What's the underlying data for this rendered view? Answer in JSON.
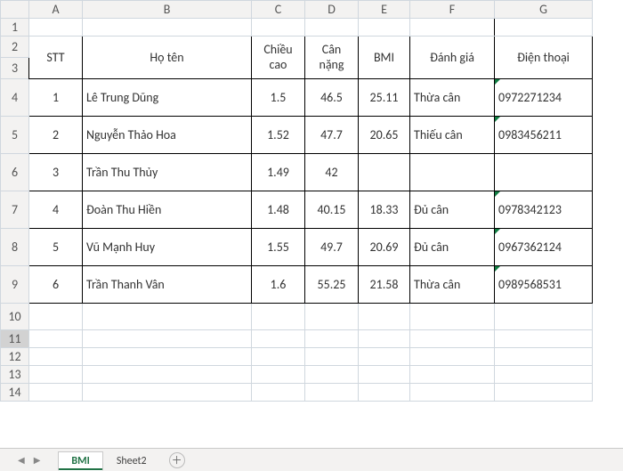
{
  "columns": [
    "A",
    "B",
    "C",
    "D",
    "E",
    "F",
    "G"
  ],
  "row_labels": [
    "1",
    "2",
    "3",
    "4",
    "5",
    "6",
    "7",
    "8",
    "9",
    "10",
    "11",
    "12",
    "13",
    "14"
  ],
  "headers": {
    "A": "STT",
    "B": "Họ tên",
    "C": "Chiều cao",
    "D": "Cân nặng",
    "E": "BMI",
    "F": "Đánh giá",
    "G": "Điện thoại"
  },
  "chart_data": {
    "type": "table",
    "rows": [
      {
        "stt": "1",
        "ho_ten": "Lê Trung Dũng",
        "chieu_cao": "1.5",
        "can_nang": "46.5",
        "bmi": "25.11",
        "danh_gia": "Thừa cân",
        "dien_thoai": "0972271234"
      },
      {
        "stt": "2",
        "ho_ten": "Nguyễn Thảo Hoa",
        "chieu_cao": "1.52",
        "can_nang": "47.7",
        "bmi": "20.65",
        "danh_gia": "Thiếu cân",
        "dien_thoai": "0983456211"
      },
      {
        "stt": "3",
        "ho_ten": "Trần Thu Thủy",
        "chieu_cao": "1.49",
        "can_nang": "42",
        "bmi": "",
        "danh_gia": "",
        "dien_thoai": ""
      },
      {
        "stt": "4",
        "ho_ten": "Đoàn Thu Hiền",
        "chieu_cao": "1.48",
        "can_nang": "40.15",
        "bmi": "18.33",
        "danh_gia": "Đủ cân",
        "dien_thoai": "0978342123"
      },
      {
        "stt": "5",
        "ho_ten": "Vũ Mạnh Huy",
        "chieu_cao": "1.55",
        "can_nang": "49.7",
        "bmi": "20.69",
        "danh_gia": "Đủ cân",
        "dien_thoai": "0967362124"
      },
      {
        "stt": "6",
        "ho_ten": "Trần Thanh Vân",
        "chieu_cao": "1.6",
        "can_nang": "55.25",
        "bmi": "21.58",
        "danh_gia": "Thừa cân",
        "dien_thoai": "0989568531"
      }
    ]
  },
  "tabs": {
    "active": "BMI",
    "sheets": [
      "BMI",
      "Sheet2"
    ]
  }
}
